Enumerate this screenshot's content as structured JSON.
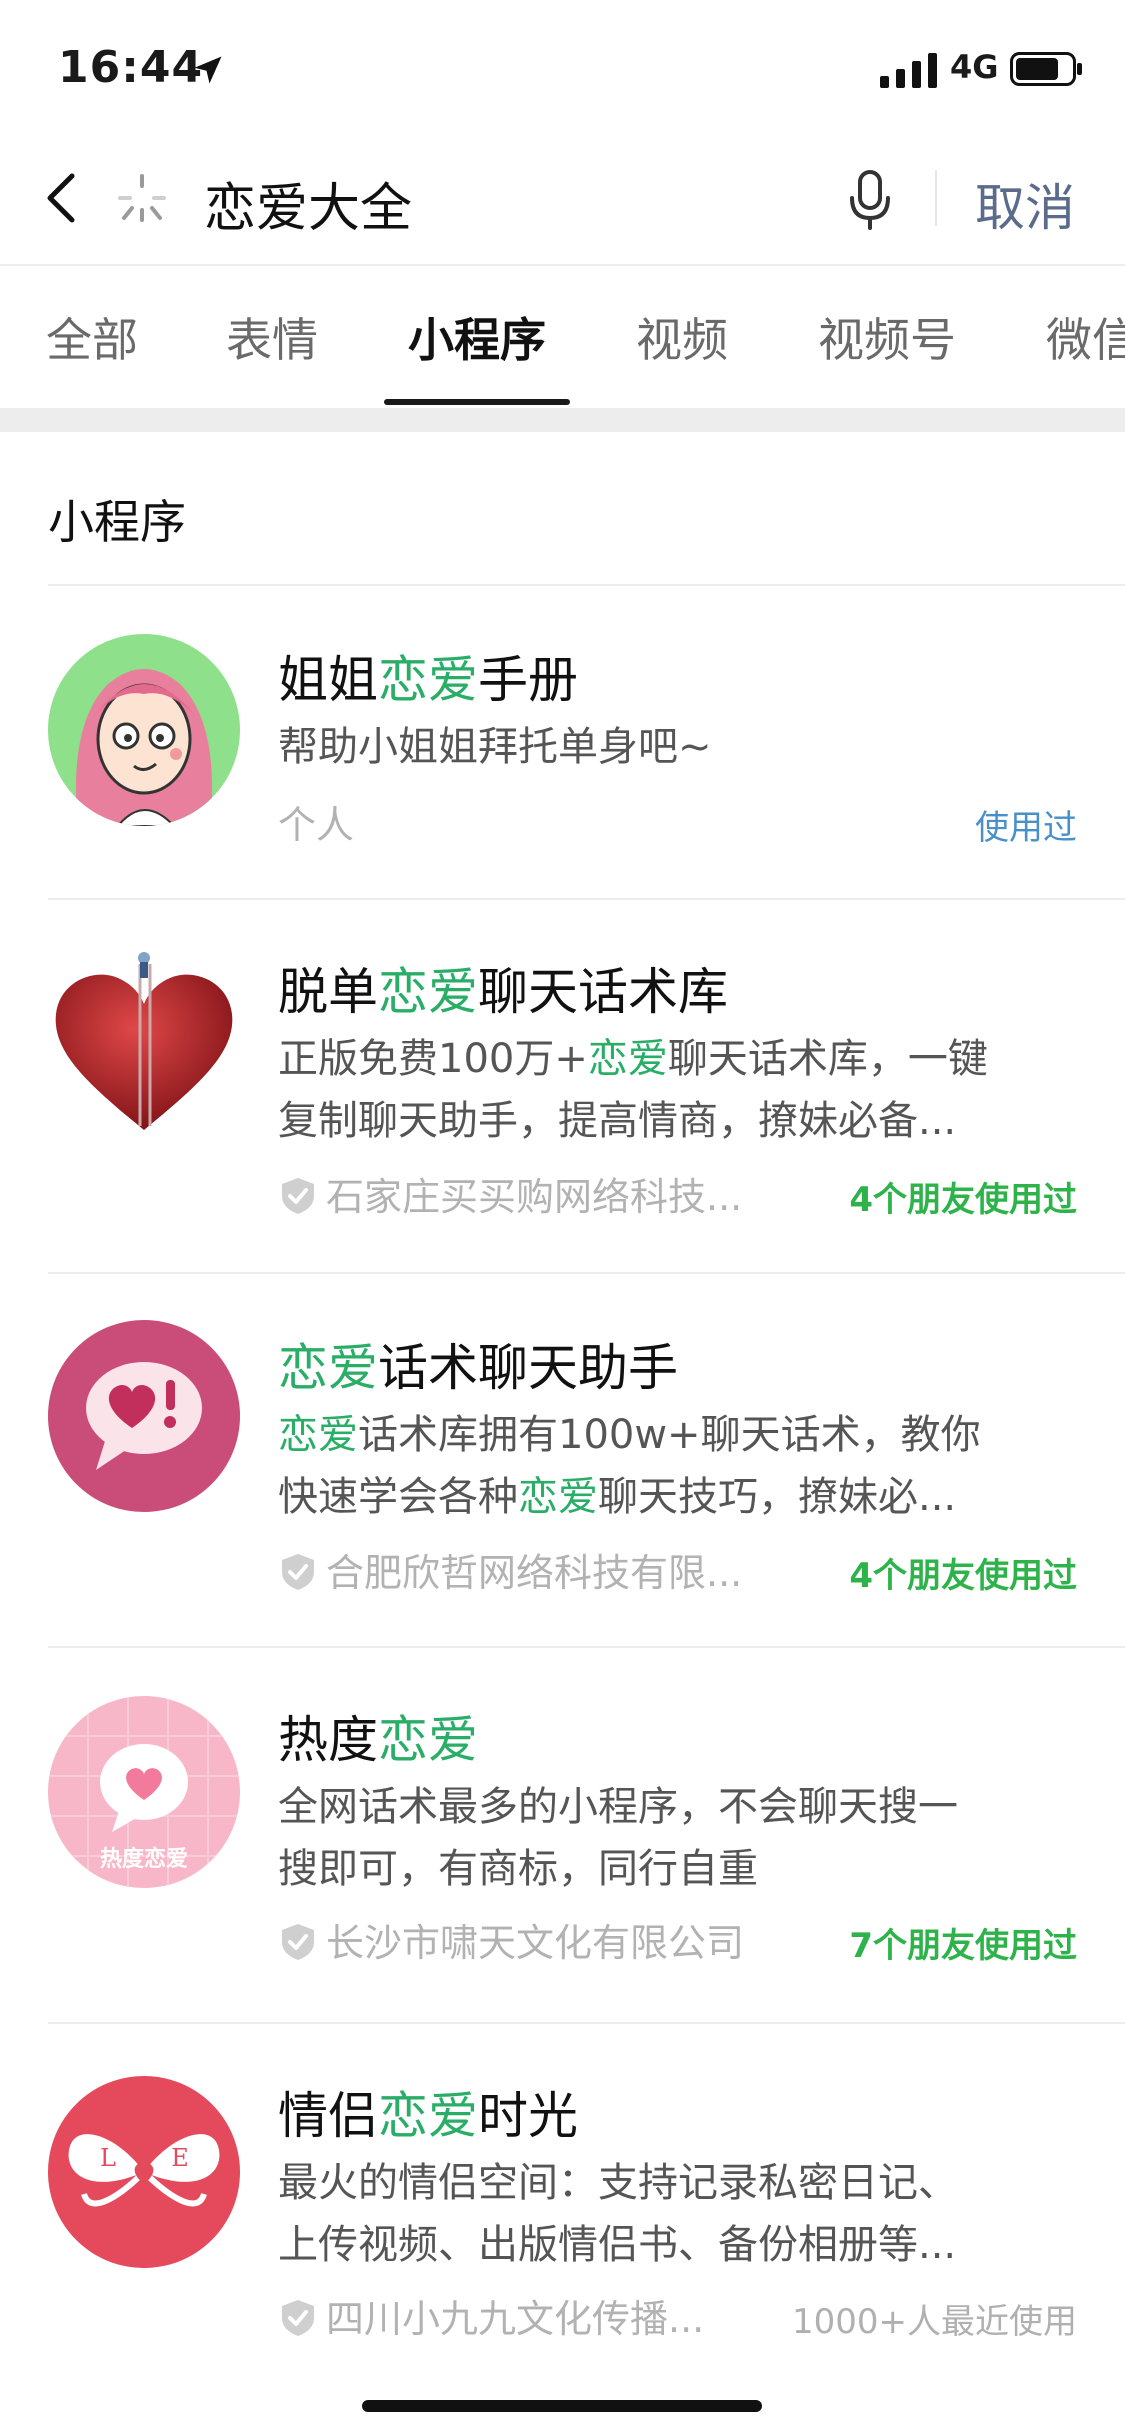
{
  "status_bar": {
    "time": "16:44",
    "network": "4G"
  },
  "search": {
    "query": "恋爱大全",
    "cancel_label": "取消"
  },
  "tabs": [
    {
      "label": "全部"
    },
    {
      "label": "表情"
    },
    {
      "label": "小程序"
    },
    {
      "label": "视频"
    },
    {
      "label": "视频号"
    },
    {
      "label": "微信"
    }
  ],
  "active_tab": "小程序",
  "section_title": "小程序",
  "highlight_color": "#2aae67",
  "results": [
    {
      "name_pre": "姐姐",
      "name_hl": "恋爱",
      "name_post": "手册",
      "desc_line1": [
        {
          "t": "帮助小姐姐拜托单身吧~",
          "hl": false
        }
      ],
      "desc_line2": [],
      "developer": "个人",
      "badge": "使用过",
      "icon": "cartoon-girl-icon"
    },
    {
      "name_pre": "脱单",
      "name_hl": "恋爱",
      "name_post": "聊天话术库",
      "desc_line1": [
        {
          "t": "正版免费100万+",
          "hl": false
        },
        {
          "t": "恋爱",
          "hl": true
        },
        {
          "t": "聊天话术库，一键",
          "hl": false
        }
      ],
      "desc_line2": [
        {
          "t": "复制聊天助手，提高情商，撩妹必备...",
          "hl": false
        }
      ],
      "developer": "石家庄买买购网络科技...",
      "badge": "4个朋友使用过",
      "icon": "red-heart-icon"
    },
    {
      "name_pre": "",
      "name_hl": "恋爱",
      "name_post": "话术聊天助手",
      "desc_line1": [
        {
          "t": "恋爱",
          "hl": true
        },
        {
          "t": "话术库拥有100w+聊天话术，教你",
          "hl": false
        }
      ],
      "desc_line2": [
        {
          "t": "快速学会各种",
          "hl": false
        },
        {
          "t": "恋爱",
          "hl": true
        },
        {
          "t": "聊天技巧，撩妹必...",
          "hl": false
        }
      ],
      "developer": "合肥欣哲网络科技有限...",
      "badge": "4个朋友使用过",
      "icon": "heart-speech-bubble-icon"
    },
    {
      "name_pre": "热度",
      "name_hl": "恋爱",
      "name_post": "",
      "desc_line1": [
        {
          "t": "全网话术最多的小程序，不会聊天搜一",
          "hl": false
        }
      ],
      "desc_line2": [
        {
          "t": "搜即可，有商标，同行自重",
          "hl": false
        }
      ],
      "developer": "长沙市啸天文化有限公司",
      "badge": "7个朋友使用过",
      "icon": "pink-heart-bubble-icon",
      "icon_text": "热度恋爱"
    },
    {
      "name_pre": "情侣",
      "name_hl": "恋爱",
      "name_post": "时光",
      "desc_line1": [
        {
          "t": "最火的情侣空间：支持记录私密日记、",
          "hl": false
        }
      ],
      "desc_line2": [
        {
          "t": "上传视频、出版情侣书、备份相册等...",
          "hl": false
        }
      ],
      "developer": "四川小九九文化传播...",
      "badge": "1000+人最近使用",
      "icon": "love-bow-icon",
      "icon_letters": [
        "L",
        "E"
      ]
    }
  ]
}
